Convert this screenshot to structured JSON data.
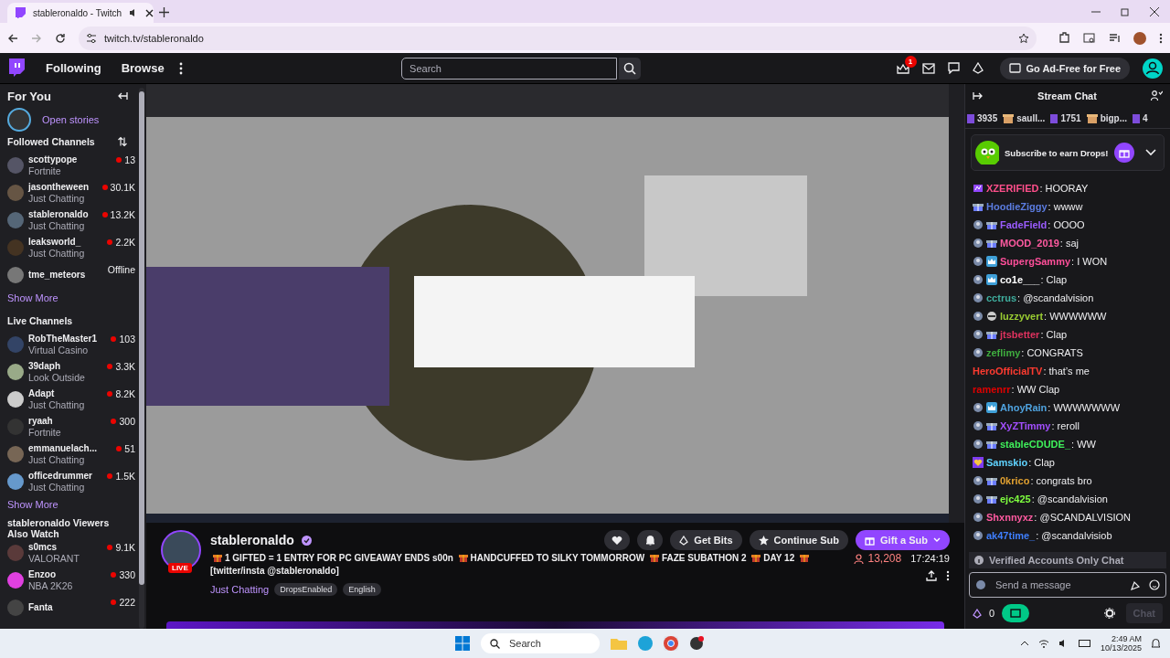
{
  "browser": {
    "tab_title": "stableronaldo - Twitch",
    "url": "twitch.tv/stableronaldo"
  },
  "nav": {
    "links": [
      "Following",
      "Browse"
    ],
    "search": {
      "placeholder": "Search"
    },
    "notification_badge": "1",
    "cta": "Go Ad-Free for Free"
  },
  "sidebar": {
    "title": "For You",
    "stories_label": "Open stories",
    "sections": [
      {
        "title": "Followed Channels",
        "sortable": true,
        "show_more": "Show More",
        "channels": [
          {
            "name": "scottypope",
            "game": "Fortnite",
            "viewers": "13",
            "live": true
          },
          {
            "name": "jasontheween",
            "game": "Just Chatting",
            "viewers": "30.1K",
            "live": true
          },
          {
            "name": "stableronaldo",
            "game": "Just Chatting",
            "viewers": "13.2K",
            "live": true
          },
          {
            "name": "leaksworld_",
            "game": "Just Chatting",
            "viewers": "2.2K",
            "live": true
          },
          {
            "name": "tme_meteors",
            "viewers": "Offline",
            "live": false
          }
        ]
      },
      {
        "title": "Live Channels",
        "sortable": false,
        "show_more": "Show More",
        "channels": [
          {
            "name": "RobTheMaster1",
            "game": "Virtual Casino",
            "viewers": "103",
            "live": true
          },
          {
            "name": "39daph",
            "game": "Look Outside",
            "viewers": "3.3K",
            "live": true
          },
          {
            "name": "Adapt",
            "game": "Just Chatting",
            "viewers": "8.2K",
            "live": true
          },
          {
            "name": "ryaah",
            "game": "Fortnite",
            "viewers": "300",
            "live": true
          },
          {
            "name": "emmanuelach...",
            "game": "Just Chatting",
            "viewers": "51",
            "live": true
          },
          {
            "name": "officedrummer",
            "game": "Just Chatting",
            "viewers": "1.5K",
            "live": true
          }
        ]
      },
      {
        "title": "stableronaldo Viewers Also Watch",
        "sortable": false,
        "channels": [
          {
            "name": "s0mcs",
            "game": "VALORANT",
            "viewers": "9.1K",
            "live": true
          },
          {
            "name": "Enzoo",
            "game": "NBA 2K26",
            "viewers": "330",
            "live": true
          },
          {
            "name": "Fanta",
            "viewers": "222",
            "live": true
          }
        ]
      }
    ]
  },
  "stream": {
    "streamer": "stableronaldo",
    "live_badge": "LIVE",
    "title_parts": [
      "1 GIFTED = 1 ENTRY FOR PC GIVEAWAY ENDS s00n",
      "HANDCUFFED TO SILKY TOMMORROW",
      "FAZE SUBATHON 2",
      "DAY 12",
      "[twitter/insta @stableronaldo]"
    ],
    "category": "Just Chatting",
    "tags": [
      "DropsEnabled",
      "English"
    ],
    "viewers": "13,208",
    "uptime": "17:24:19",
    "get_bits": "Get Bits",
    "continue_sub": "Continue Sub",
    "gift_sub": "Gift a Sub"
  },
  "chat": {
    "title": "Stream Chat",
    "leaderboard": [
      {
        "kind": "count",
        "text": "3935"
      },
      {
        "kind": "user",
        "text": "saull..."
      },
      {
        "kind": "count",
        "text": "1751"
      },
      {
        "kind": "user",
        "text": "bigp..."
      },
      {
        "kind": "count",
        "text": "4"
      }
    ],
    "drops_banner": "Subscribe to earn Drops!",
    "messages": [
      {
        "user": "XZERIFIED",
        "text": ": HOORAY",
        "color": "#ff4f8b",
        "badges": [
          {
            "kind": "bits"
          }
        ]
      },
      {
        "user": "HoodieZiggy",
        "text": ": wwww",
        "color": "#5b7ce0",
        "badges": [
          {
            "kind": "gift"
          }
        ]
      },
      {
        "user": "FadeField",
        "text": ": OOOO",
        "color": "#9b5cff",
        "badges": [
          {
            "kind": "sub"
          },
          {
            "kind": "gift"
          }
        ]
      },
      {
        "user": "MOOD_2019",
        "text": ": saj",
        "color": "#ff5aa0",
        "badges": [
          {
            "kind": "sub"
          },
          {
            "kind": "gift"
          }
        ]
      },
      {
        "user": "SupergSammy",
        "text": ": I WON",
        "color": "#ff4f9a",
        "badges": [
          {
            "kind": "sub"
          },
          {
            "kind": "crown"
          }
        ]
      },
      {
        "user": "co1e___",
        "text": ": Clap",
        "color": "#ffffff",
        "badges": [
          {
            "kind": "sub"
          },
          {
            "kind": "crown"
          }
        ]
      },
      {
        "user": "cctrus",
        "text": ": @scandalvision",
        "color": "#3fae9e",
        "badges": [
          {
            "kind": "sub"
          }
        ]
      },
      {
        "user": "luzzyvert",
        "text": ": WWWWWW",
        "color": "#9acd32",
        "badges": [
          {
            "kind": "sub"
          },
          {
            "kind": "mask"
          }
        ]
      },
      {
        "user": "jtsbetter",
        "text": ": Clap",
        "color": "#e0325f",
        "badges": [
          {
            "kind": "sub"
          },
          {
            "kind": "gift"
          }
        ]
      },
      {
        "user": "zeflimy",
        "text": ": CONGRATS",
        "color": "#3fae3f",
        "badges": [
          {
            "kind": "sub"
          }
        ]
      },
      {
        "user": "HeroOfficialTV",
        "text": ": that’s me",
        "color": "#ff3b30"
      },
      {
        "user": "ramenrr",
        "text": ": WW Clap",
        "color": "#e00000"
      },
      {
        "user": "AhoyRain",
        "text": ": WWWWWWW",
        "color": "#4fa3e0",
        "badges": [
          {
            "kind": "sub"
          },
          {
            "kind": "crown"
          }
        ]
      },
      {
        "user": "XyZTimmy",
        "text": ": reroll",
        "color": "#a34fff",
        "badges": [
          {
            "kind": "sub"
          },
          {
            "kind": "gift"
          }
        ]
      },
      {
        "user": "stableCDUDE_",
        "text": ": WW",
        "color": "#3ff05a",
        "badges": [
          {
            "kind": "sub"
          },
          {
            "kind": "gift"
          }
        ]
      },
      {
        "user": "Samskio",
        "text": ": Clap",
        "color": "#5fd3ff",
        "badges": [
          {
            "kind": "heart"
          }
        ]
      },
      {
        "user": "0krico",
        "text": ": congrats bro",
        "color": "#e0a030",
        "badges": [
          {
            "kind": "sub"
          },
          {
            "kind": "gift"
          }
        ]
      },
      {
        "user": "ejc425",
        "text": ": @scandalvision",
        "color": "#7fff3f",
        "badges": [
          {
            "kind": "sub"
          },
          {
            "kind": "gift"
          }
        ]
      },
      {
        "user": "Shxnnyxz",
        "text": ": @SCANDALVISION",
        "color": "#ff5aa0",
        "badges": [
          {
            "kind": "sub"
          }
        ]
      },
      {
        "user": "ak47time_",
        "text": ": @scandalvisiob",
        "color": "#3f7fff",
        "badges": [
          {
            "kind": "sub"
          }
        ]
      }
    ],
    "notice": "Verified Accounts Only Chat",
    "input": {
      "placeholder": "Send a message"
    },
    "points": "0",
    "send_button": {
      "label": "Chat",
      "disabled": true
    }
  },
  "taskbar": {
    "search": {
      "placeholder": "Search"
    },
    "time": "2:49 AM",
    "date": "10/13/2025"
  }
}
